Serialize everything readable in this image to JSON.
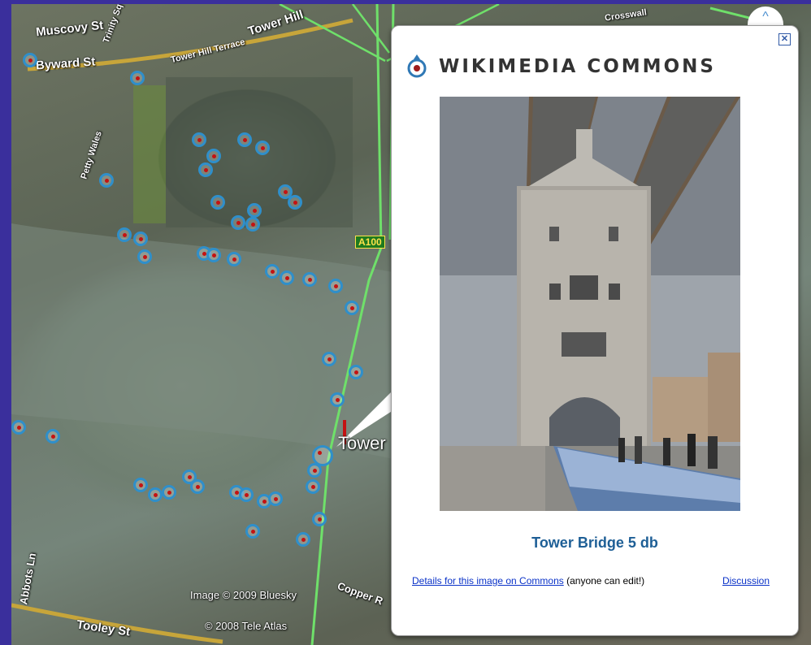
{
  "map": {
    "labels": {
      "muscovy": "Muscovy St",
      "byward": "Byward St",
      "trinity": "Trinity Sq",
      "tower_hill_terrace": "Tower Hill Terrace",
      "tower_hill": "Tower Hill",
      "petty_wales": "Petty Wales",
      "crosst": "Crosswall",
      "a100": "A100",
      "tower": "Tower",
      "abbots": "Abbots Ln",
      "tooley": "Tooley St",
      "copper": "Copper R",
      "copyright_image": "Image © 2009 Bluesky",
      "copyright_tele": "© 2008 Tele Atlas"
    },
    "colors": {
      "road_green": "#6fe06a",
      "road_yellow": "#c7a53a",
      "pin_ring": "#2f8fca",
      "pin_dot": "#c41212"
    }
  },
  "popup": {
    "logo_text": "WIKIMEDIA COMMONS",
    "close_label": "✕",
    "image_alt": "Tower Bridge photograph",
    "caption": "Tower Bridge 5 db",
    "details_link": "Details for this image on Commons",
    "details_suffix": "(anyone can edit!)",
    "discussion_link": "Discussion"
  },
  "controls": {
    "collapse_icon": "^"
  }
}
